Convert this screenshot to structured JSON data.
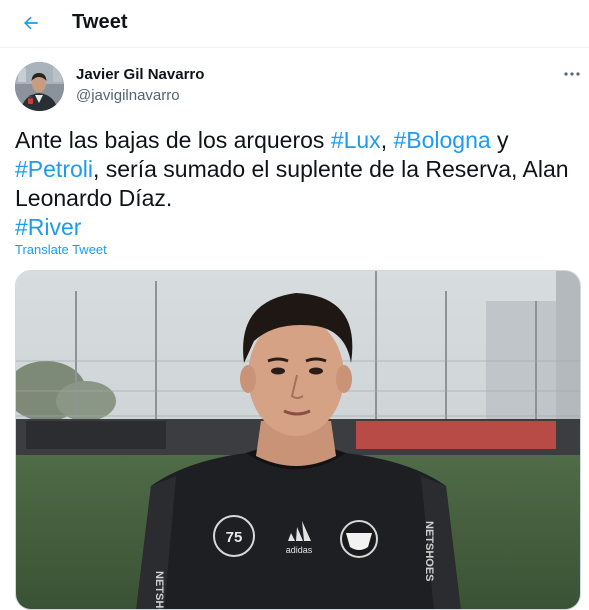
{
  "header": {
    "title": "Tweet"
  },
  "author": {
    "name": "Javier Gil Navarro",
    "handle": "@javigilnavarro"
  },
  "tweet": {
    "text_parts": [
      {
        "text": "Ante las bajas de los arqueros ",
        "hashtag": false
      },
      {
        "text": "#Lux",
        "hashtag": true
      },
      {
        "text": ", ",
        "hashtag": false
      },
      {
        "text": "#Bologna",
        "hashtag": true
      },
      {
        "text": " y ",
        "hashtag": false
      },
      {
        "text": "#Petroli",
        "hashtag": true
      },
      {
        "text": ", sería sumado el suplente de la Reserva, Alan Leonardo Díaz.",
        "hashtag": false
      },
      {
        "text": "#River",
        "hashtag": true,
        "newline_before": true
      }
    ],
    "translate_label": "Translate Tweet"
  },
  "media": {
    "jersey_number": "75",
    "jersey_brand": "adidas",
    "sleeve_text": "NETSHOES"
  },
  "colors": {
    "accent": "#1d9bf0",
    "text": "#0f1419",
    "secondary": "#536471"
  },
  "icons": {
    "back": "arrow-left-icon",
    "more": "more-dots-icon"
  }
}
